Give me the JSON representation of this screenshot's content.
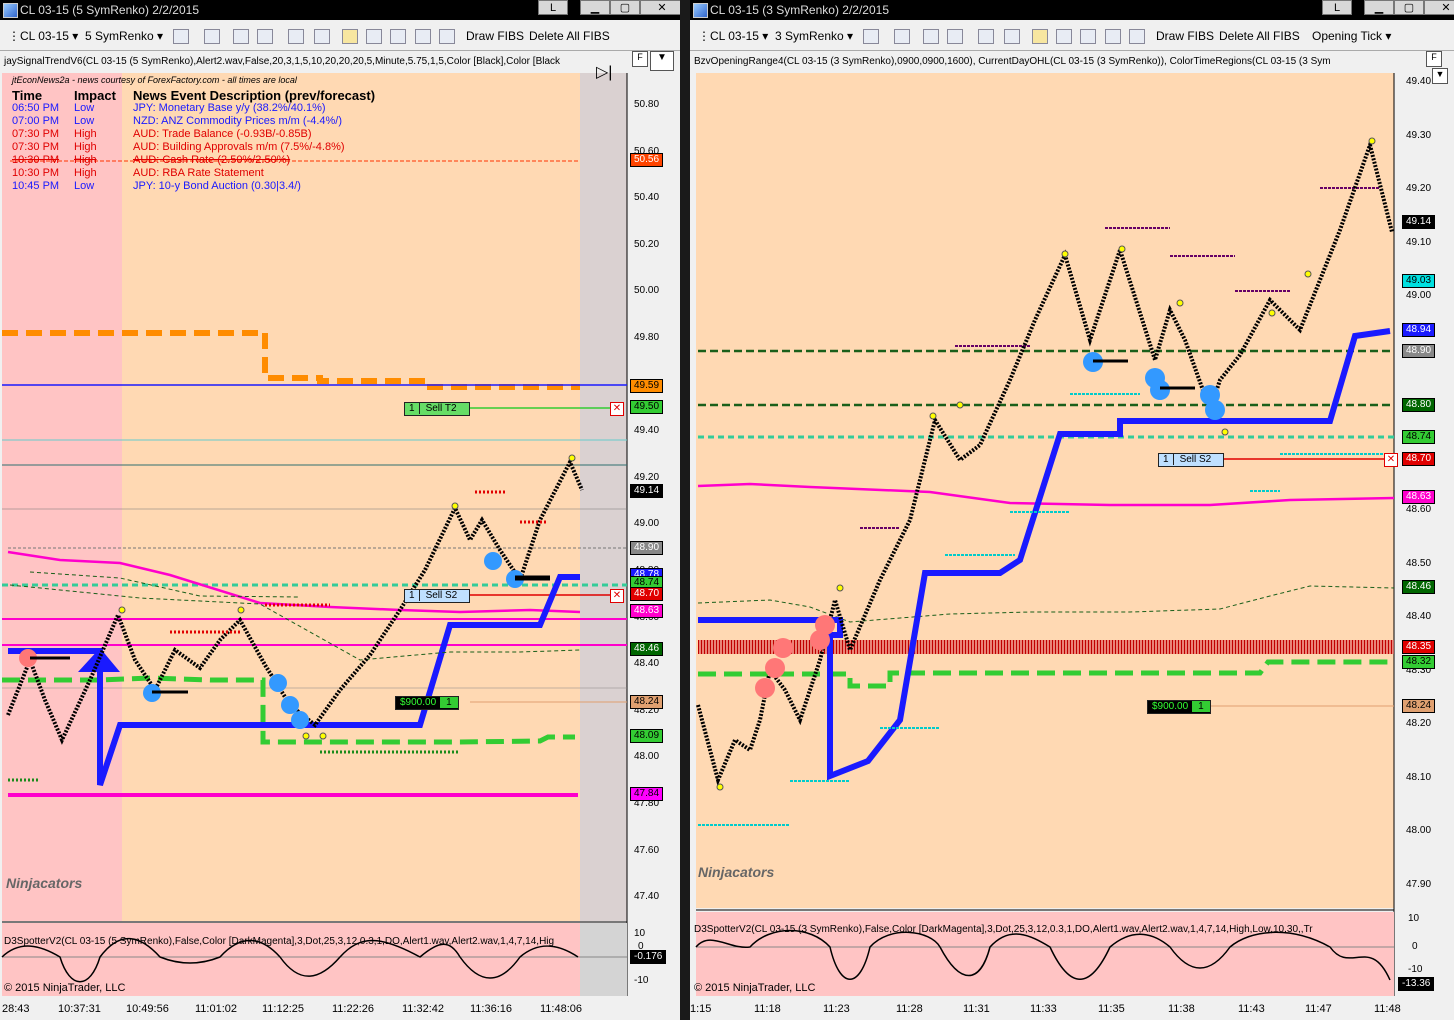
{
  "left": {
    "title": "CL 03-15 (5 SymRenko)  2/2/2015",
    "instrument": "CL 03-15",
    "period": "5 SymRenko",
    "draw_fibs": "Draw FIBS",
    "delete_fibs": "Delete All FIBS",
    "indicator_label": "jaySignalTrendV6(CL 03-15 (5 SymRenko),Alert2.wav,False,20,3,1,5,10,20,20,20,5,Minute,5.75,1,5,Color [Black],Color [Black",
    "news_source": "jtEconNews2a - news courtesy of ForexFactory.com - all times are local",
    "news_headers": {
      "time": "Time",
      "impact": "Impact",
      "desc": "News Event Description (prev/forecast)"
    },
    "news": [
      {
        "time": "06:50 PM",
        "impact": "Low",
        "desc": "JPY: Monetary Base y/y (38.2%/40.1%)",
        "color": "#1a1aff"
      },
      {
        "time": "07:00 PM",
        "impact": "Low",
        "desc": "NZD: ANZ Commodity Prices m/m (-4.4%/)",
        "color": "#1a1aff"
      },
      {
        "time": "07:30 PM",
        "impact": "High",
        "desc": "AUD: Trade Balance (-0.93B/-0.85B)",
        "color": "#e00000"
      },
      {
        "time": "07:30 PM",
        "impact": "High",
        "desc": "AUD: Building Approvals m/m (7.5%/-4.8%)",
        "color": "#e00000"
      },
      {
        "time": "10:30 PM",
        "impact": "High",
        "desc": "AUD: Cash Rate (2.50%/2.50%)",
        "color": "#e00000"
      },
      {
        "time": "10:30 PM",
        "impact": "High",
        "desc": "AUD: RBA Rate Statement",
        "color": "#e00000"
      },
      {
        "time": "10:45 PM",
        "impact": "Low",
        "desc": "JPY: 10-y Bond Auction (0.30|3.4/)",
        "color": "#1a1aff"
      }
    ],
    "price_ticks": [
      "50.80",
      "50.60",
      "50.40",
      "50.20",
      "50.00",
      "49.80",
      "49.60",
      "49.40",
      "49.20",
      "49.00",
      "48.80",
      "48.60",
      "48.40",
      "48.20",
      "48.00",
      "47.80",
      "47.60",
      "47.40"
    ],
    "price_labels": [
      {
        "v": "50.56",
        "bg": "#ff4400",
        "fg": "#fff"
      },
      {
        "v": "49.59",
        "bg": "#ff8c00",
        "fg": "#000"
      },
      {
        "v": "49.50",
        "bg": "#33cc33",
        "fg": "#000"
      },
      {
        "v": "49.14",
        "bg": "#000",
        "fg": "#fff"
      },
      {
        "v": "48.90",
        "bg": "#888",
        "fg": "#fff"
      },
      {
        "v": "48.78",
        "bg": "#1a1aff",
        "fg": "#fff"
      },
      {
        "v": "48.74",
        "bg": "#33cc33",
        "fg": "#000"
      },
      {
        "v": "48.70",
        "bg": "#e00000",
        "fg": "#fff"
      },
      {
        "v": "48.63",
        "bg": "#ff00cc",
        "fg": "#fff"
      },
      {
        "v": "48.46",
        "bg": "#006600",
        "fg": "#fff"
      },
      {
        "v": "48.24",
        "bg": "#e0a070",
        "fg": "#000"
      },
      {
        "v": "48.09",
        "bg": "#33cc33",
        "fg": "#000"
      },
      {
        "v": "47.84",
        "bg": "#ff00ff",
        "fg": "#000"
      }
    ],
    "sell_t2": "Sell T2",
    "sell_s2": "Sell S2",
    "order_qty": "1",
    "profit": "$900.00",
    "osc_label": "D3SpotterV2(CL 03-15 (5 SymRenko),False,Color [DarkMagenta],3,Dot,25,3,12,0.3,1,DO,Alert1.wav,Alert2.wav,1,4,7,14,Hig",
    "osc_ticks": [
      "10",
      "0",
      "-10"
    ],
    "osc_value": "-0.176",
    "times": [
      "28:43",
      "10:37:31",
      "10:49:56",
      "11:01:02",
      "11:12:25",
      "11:22:26",
      "11:32:42",
      "11:36:16",
      "11:48:06"
    ],
    "copyright": "© 2015 NinjaTrader, LLC",
    "logo": "Ninjacators"
  },
  "right": {
    "title": "CL 03-15 (3 SymRenko)  2/2/2015",
    "instrument": "CL 03-15",
    "period": "3 SymRenko",
    "draw_fibs": "Draw FIBS",
    "delete_fibs": "Delete All FIBS",
    "tick_mode": "Opening Tick",
    "indicator_label": "BzvOpeningRange4(CL 03-15 (3 SymRenko),0900,0900,1600), CurrentDayOHL(CL 03-15 (3 SymRenko)), ColorTimeRegions(CL 03-15 (3 Sym",
    "price_ticks": [
      "49.40",
      "49.30",
      "49.20",
      "49.10",
      "49.00",
      "48.90",
      "48.80",
      "48.70",
      "48.60",
      "48.50",
      "48.40",
      "48.30",
      "48.20",
      "48.10",
      "48.00",
      "47.90"
    ],
    "price_labels": [
      {
        "v": "49.14",
        "bg": "#000",
        "fg": "#fff"
      },
      {
        "v": "49.03",
        "bg": "#00e0e0",
        "fg": "#000"
      },
      {
        "v": "48.94",
        "bg": "#1a1aff",
        "fg": "#fff"
      },
      {
        "v": "48.90",
        "bg": "#888",
        "fg": "#fff"
      },
      {
        "v": "48.80",
        "bg": "#006600",
        "fg": "#fff"
      },
      {
        "v": "48.74",
        "bg": "#33cc33",
        "fg": "#000"
      },
      {
        "v": "48.70",
        "bg": "#e00000",
        "fg": "#fff"
      },
      {
        "v": "48.63",
        "bg": "#ff00cc",
        "fg": "#fff"
      },
      {
        "v": "48.46",
        "bg": "#006600",
        "fg": "#fff"
      },
      {
        "v": "48.35",
        "bg": "#e00000",
        "fg": "#fff"
      },
      {
        "v": "48.32",
        "bg": "#33cc33",
        "fg": "#000"
      },
      {
        "v": "48.24",
        "bg": "#e0a070",
        "fg": "#000"
      }
    ],
    "sell_s2": "Sell S2",
    "order_qty": "1",
    "profit": "$900.00",
    "osc_label": "D3SpotterV2(CL 03-15 (3 SymRenko),False,Color [DarkMagenta],3,Dot,25,3,12,0.3,1,DO,Alert1.wav,Alert2.wav,1,4,7,14,High,Low,10,30,,Tr",
    "osc_ticks": [
      "10",
      "0",
      "-10"
    ],
    "osc_value": "-13.36",
    "times": [
      "1:15",
      "11:18",
      "11:23",
      "11:28",
      "11:31",
      "11:33",
      "11:35",
      "11:38",
      "11:43",
      "11:47",
      "11:48"
    ],
    "copyright": "© 2015 NinjaTrader, LLC",
    "logo": "Ninjacators"
  }
}
